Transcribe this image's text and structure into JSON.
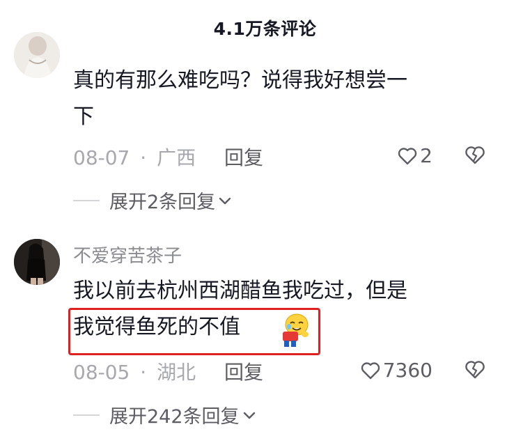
{
  "header": {
    "title": "4.1万条评论"
  },
  "comments": [
    {
      "text_lines": [
        "真的有那么难吃吗？说得我好想尝一",
        "下"
      ],
      "date": "08-07",
      "separator": "·",
      "location": "广西",
      "reply_label": "回复",
      "likes": "2",
      "expand_label": "展开2条回复"
    },
    {
      "username": "不爱穿苦茶子",
      "text_lines": [
        "我以前去杭州西湖醋鱼我吃过，但是",
        "我觉得鱼死的不值"
      ],
      "date": "08-05",
      "separator": "·",
      "location": "湖北",
      "reply_label": "回复",
      "likes": "7360",
      "expand_label": "展开242条回复"
    }
  ],
  "colors": {
    "highlight": "#e02020",
    "text": "#161823",
    "muted": "#a7a8ad"
  }
}
